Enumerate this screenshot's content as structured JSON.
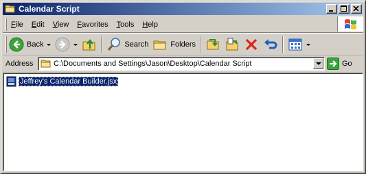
{
  "window": {
    "title": "Calendar Script"
  },
  "menu": {
    "items": [
      "File",
      "Edit",
      "View",
      "Favorites",
      "Tools",
      "Help"
    ]
  },
  "toolbar": {
    "back_label": "Back",
    "search_label": "Search",
    "folders_label": "Folders"
  },
  "address": {
    "label": "Address",
    "path": "C:\\Documents and Settings\\Jason\\Desktop\\Calendar Script",
    "go_label": "Go"
  },
  "files": [
    {
      "name": "Jeffrey's Calendar Builder.jsx",
      "selected": true
    }
  ],
  "colors": {
    "title_start": "#0a246a",
    "title_end": "#a6caf0",
    "selection": "#0a246a",
    "chrome": "#d4d0c8"
  }
}
